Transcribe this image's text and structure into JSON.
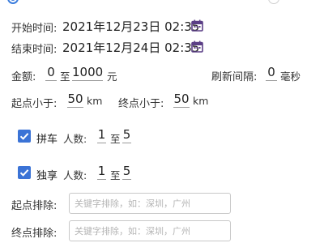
{
  "top_radios": {
    "left_selected": true
  },
  "start_time": {
    "label": "开始时间:",
    "value": "2021年12月23日 02:35"
  },
  "end_time": {
    "label": "结束时间:",
    "value": "2021年12月24日 02:35"
  },
  "amount": {
    "label": "金额:",
    "min": "0",
    "sep": "至",
    "max": "1000",
    "unit": "元"
  },
  "refresh": {
    "label": "刷新间隔:",
    "value": "0",
    "unit": "毫秒"
  },
  "start_dist": {
    "label": "起点小于:",
    "value": "50",
    "unit": "km"
  },
  "end_dist": {
    "label": "终点小于:",
    "value": "50",
    "unit": "km"
  },
  "carpool": {
    "label": "拼车",
    "checked": true,
    "people_label": "人数:",
    "min": "1",
    "sep": "至",
    "max": "5"
  },
  "exclusive": {
    "label": "独享",
    "checked": true,
    "people_label": "人数:",
    "min": "1",
    "sep": "至",
    "max": "5"
  },
  "start_exclude": {
    "label": "起点排除:",
    "placeholder": "关键字排除，如：深圳，广州",
    "value": ""
  },
  "end_exclude": {
    "label": "终点排除:",
    "placeholder": "关键字排除，如：深圳，广州",
    "value": ""
  },
  "colors": {
    "accent": "#3b73d6",
    "calendar_icon": "#5b3f86"
  }
}
